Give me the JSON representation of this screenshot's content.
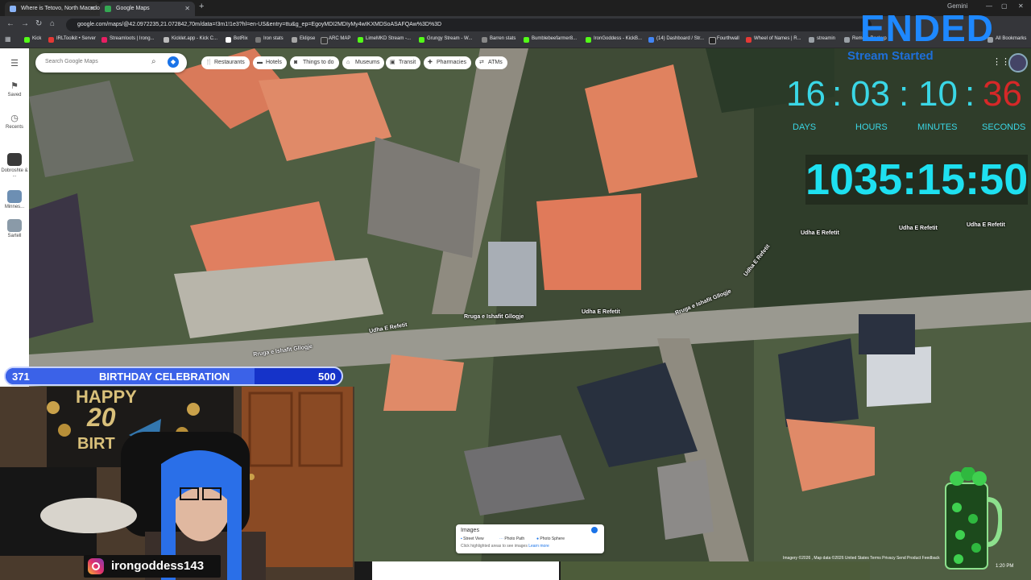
{
  "browser": {
    "tabs": [
      {
        "title": "Where is Tetovo, North Macedo",
        "active": false
      },
      {
        "title": "Google Maps",
        "active": true
      }
    ],
    "window_profile": "Gemini",
    "url": "google.com/maps/@42.0972235,21.072842,70m/data=!3m1!1e3?hl=en-US&entry=ttu&g_ep=EgoyMDI2MDIyMy4wIKXMDSoASAFQAw%3D%3D",
    "bookmarks": [
      "Kick",
      "IRLToolkit • Server",
      "Streamloots | Irong...",
      "Kicklet.app - Kick C...",
      "BotRix",
      "Iron stats",
      "Eklipse",
      "ARC MAP",
      "LimeMKD Stream -...",
      "Grungy Stream - W...",
      "Barren stats",
      "Bumblebeefarmer8...",
      "IronGoddess - KickB...",
      "(14) Dashboard / Str...",
      "Fourthwall",
      "Wheel of Names | R...",
      "streamin",
      "Remote Backup",
      "All Bookmarks"
    ]
  },
  "maps": {
    "search_placeholder": "Search Google Maps",
    "chips": [
      "Restaurants",
      "Hotels",
      "Things to do",
      "Museums",
      "Transit",
      "Pharmacies",
      "ATMs"
    ],
    "rail": [
      {
        "icon": "menu-icon",
        "label": ""
      },
      {
        "icon": "bookmark-icon",
        "label": "Saved"
      },
      {
        "icon": "history-icon",
        "label": "Recents"
      },
      {
        "icon": "thumb",
        "label": "Dobroshte & ..."
      },
      {
        "icon": "thumb",
        "label": "Minnes..."
      },
      {
        "icon": "thumb",
        "label": "Sartell"
      }
    ],
    "road_labels": [
      "Udha E Refetit",
      "Udha E Refetit",
      "Udha E Refetit",
      "Udha E Refetit",
      "Udha E Refetit",
      "Udha E Refetit",
      "Rruga e Ishafit Gllogje",
      "Rruga e Ishafit Gllogje",
      "Rruga e Ishafit Gllogje"
    ],
    "images_panel": {
      "title": "Images",
      "legend": [
        "Street View",
        "Photo Path",
        "Photo Sphere"
      ],
      "hint": "Click highlighted areas to see images",
      "link": "Learn more"
    },
    "attribution": "Imagery ©2026 , Map data ©2026   United States   Terms   Privacy   Send Product Feedback",
    "clock": "1:20 PM"
  },
  "overlay": {
    "ended": "ENDED",
    "stream_started": "Stream Started",
    "countdown": {
      "days": "16",
      "hours": "03",
      "minutes": "10",
      "seconds": "36"
    },
    "countdown_labels": {
      "days": "DAYS",
      "hours": "HOURS",
      "minutes": "MINUTES",
      "seconds": "SECONDS"
    },
    "elapsed": "1035:15:50",
    "goal": {
      "current": "371",
      "title": "BIRTHDAY CELEBRATION",
      "target": "500",
      "progress": 0.742
    },
    "instagram": "irongoddess143",
    "banner": [
      "HAPPY",
      "20",
      "BIRT"
    ]
  },
  "colors": {
    "accent": "#1e88ff",
    "timer": "#3ad7e6",
    "seconds": "#d62828",
    "goal": "#1533c9"
  }
}
